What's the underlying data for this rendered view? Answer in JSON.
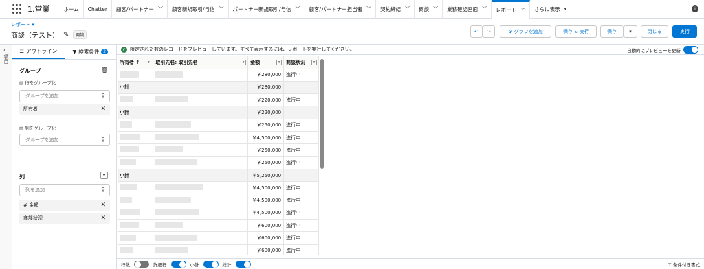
{
  "nav": {
    "app_name": "1.営業",
    "items": [
      "ホーム",
      "Chatter",
      "顧客/パートナー",
      "顧客新規取引/与信",
      "パートナー新規取引/与信",
      "顧客/パートナー担当者",
      "契約締結",
      "商談",
      "業務確認画面",
      "レポート",
      "さらに表示"
    ]
  },
  "header": {
    "breadcrumb": "レポート ▾",
    "title": "商談（テスト）",
    "badge": "商談",
    "buttons": {
      "undo": "↶",
      "redo": "↷",
      "add_chart": "グラフを追加",
      "save_run": "保存 & 実行",
      "save": "保存",
      "close": "閉じる",
      "run": "実行"
    }
  },
  "left_rail": {
    "label": "項目"
  },
  "panel": {
    "tab_outline": "アウトライン",
    "tab_filters": "検索条件",
    "filter_count": "2",
    "group_title": "グループ",
    "group_rows_label": "行をグループ化",
    "group_rows_placeholder": "グループを追加...",
    "group_rows_item": "所有者",
    "group_cols_label": "列をグループ化",
    "group_cols_placeholder": "グループを追加...",
    "columns_title": "列",
    "columns_placeholder": "列を追加...",
    "column_items": [
      "# 金額",
      "商談状況"
    ]
  },
  "banner": {
    "text": "限定された数のレコードをプレビューしています。すべて表示するには、レポートを実行してください。",
    "auto_preview": "自動的にプレビューを更新"
  },
  "table": {
    "headers": [
      "所有者 ↑",
      "取引先名: 取引先名",
      "金額",
      "商談状況"
    ],
    "rows": [
      {
        "type": "row",
        "amount": "￥280,000",
        "status": "進行中"
      },
      {
        "type": "sub",
        "label": "小計",
        "amount": "￥280,000"
      },
      {
        "type": "row",
        "amount": "￥220,000",
        "status": "進行中"
      },
      {
        "type": "sub",
        "label": "小計",
        "amount": "￥220,000"
      },
      {
        "type": "row",
        "amount": "￥250,000",
        "status": "進行中"
      },
      {
        "type": "row",
        "amount": "￥4,500,000",
        "status": "進行中"
      },
      {
        "type": "row",
        "amount": "￥250,000",
        "status": "進行中"
      },
      {
        "type": "row",
        "amount": "￥250,000",
        "status": "進行中"
      },
      {
        "type": "sub",
        "label": "小計",
        "amount": "￥5,250,000"
      },
      {
        "type": "row",
        "amount": "￥4,500,000",
        "status": "進行中"
      },
      {
        "type": "row",
        "amount": "￥4,500,000",
        "status": "進行中"
      },
      {
        "type": "row",
        "amount": "￥4,500,000",
        "status": "進行中"
      },
      {
        "type": "row",
        "amount": "￥600,000",
        "status": "進行中"
      },
      {
        "type": "row",
        "amount": "￥600,000",
        "status": "進行中"
      },
      {
        "type": "row",
        "amount": "￥600,000",
        "status": "進行中"
      }
    ]
  },
  "footer": {
    "row_count": "行数",
    "detail_rows": "詳細行",
    "subtotal": "小計",
    "grand_total": "総計",
    "conditional_format": "条件付き書式"
  }
}
